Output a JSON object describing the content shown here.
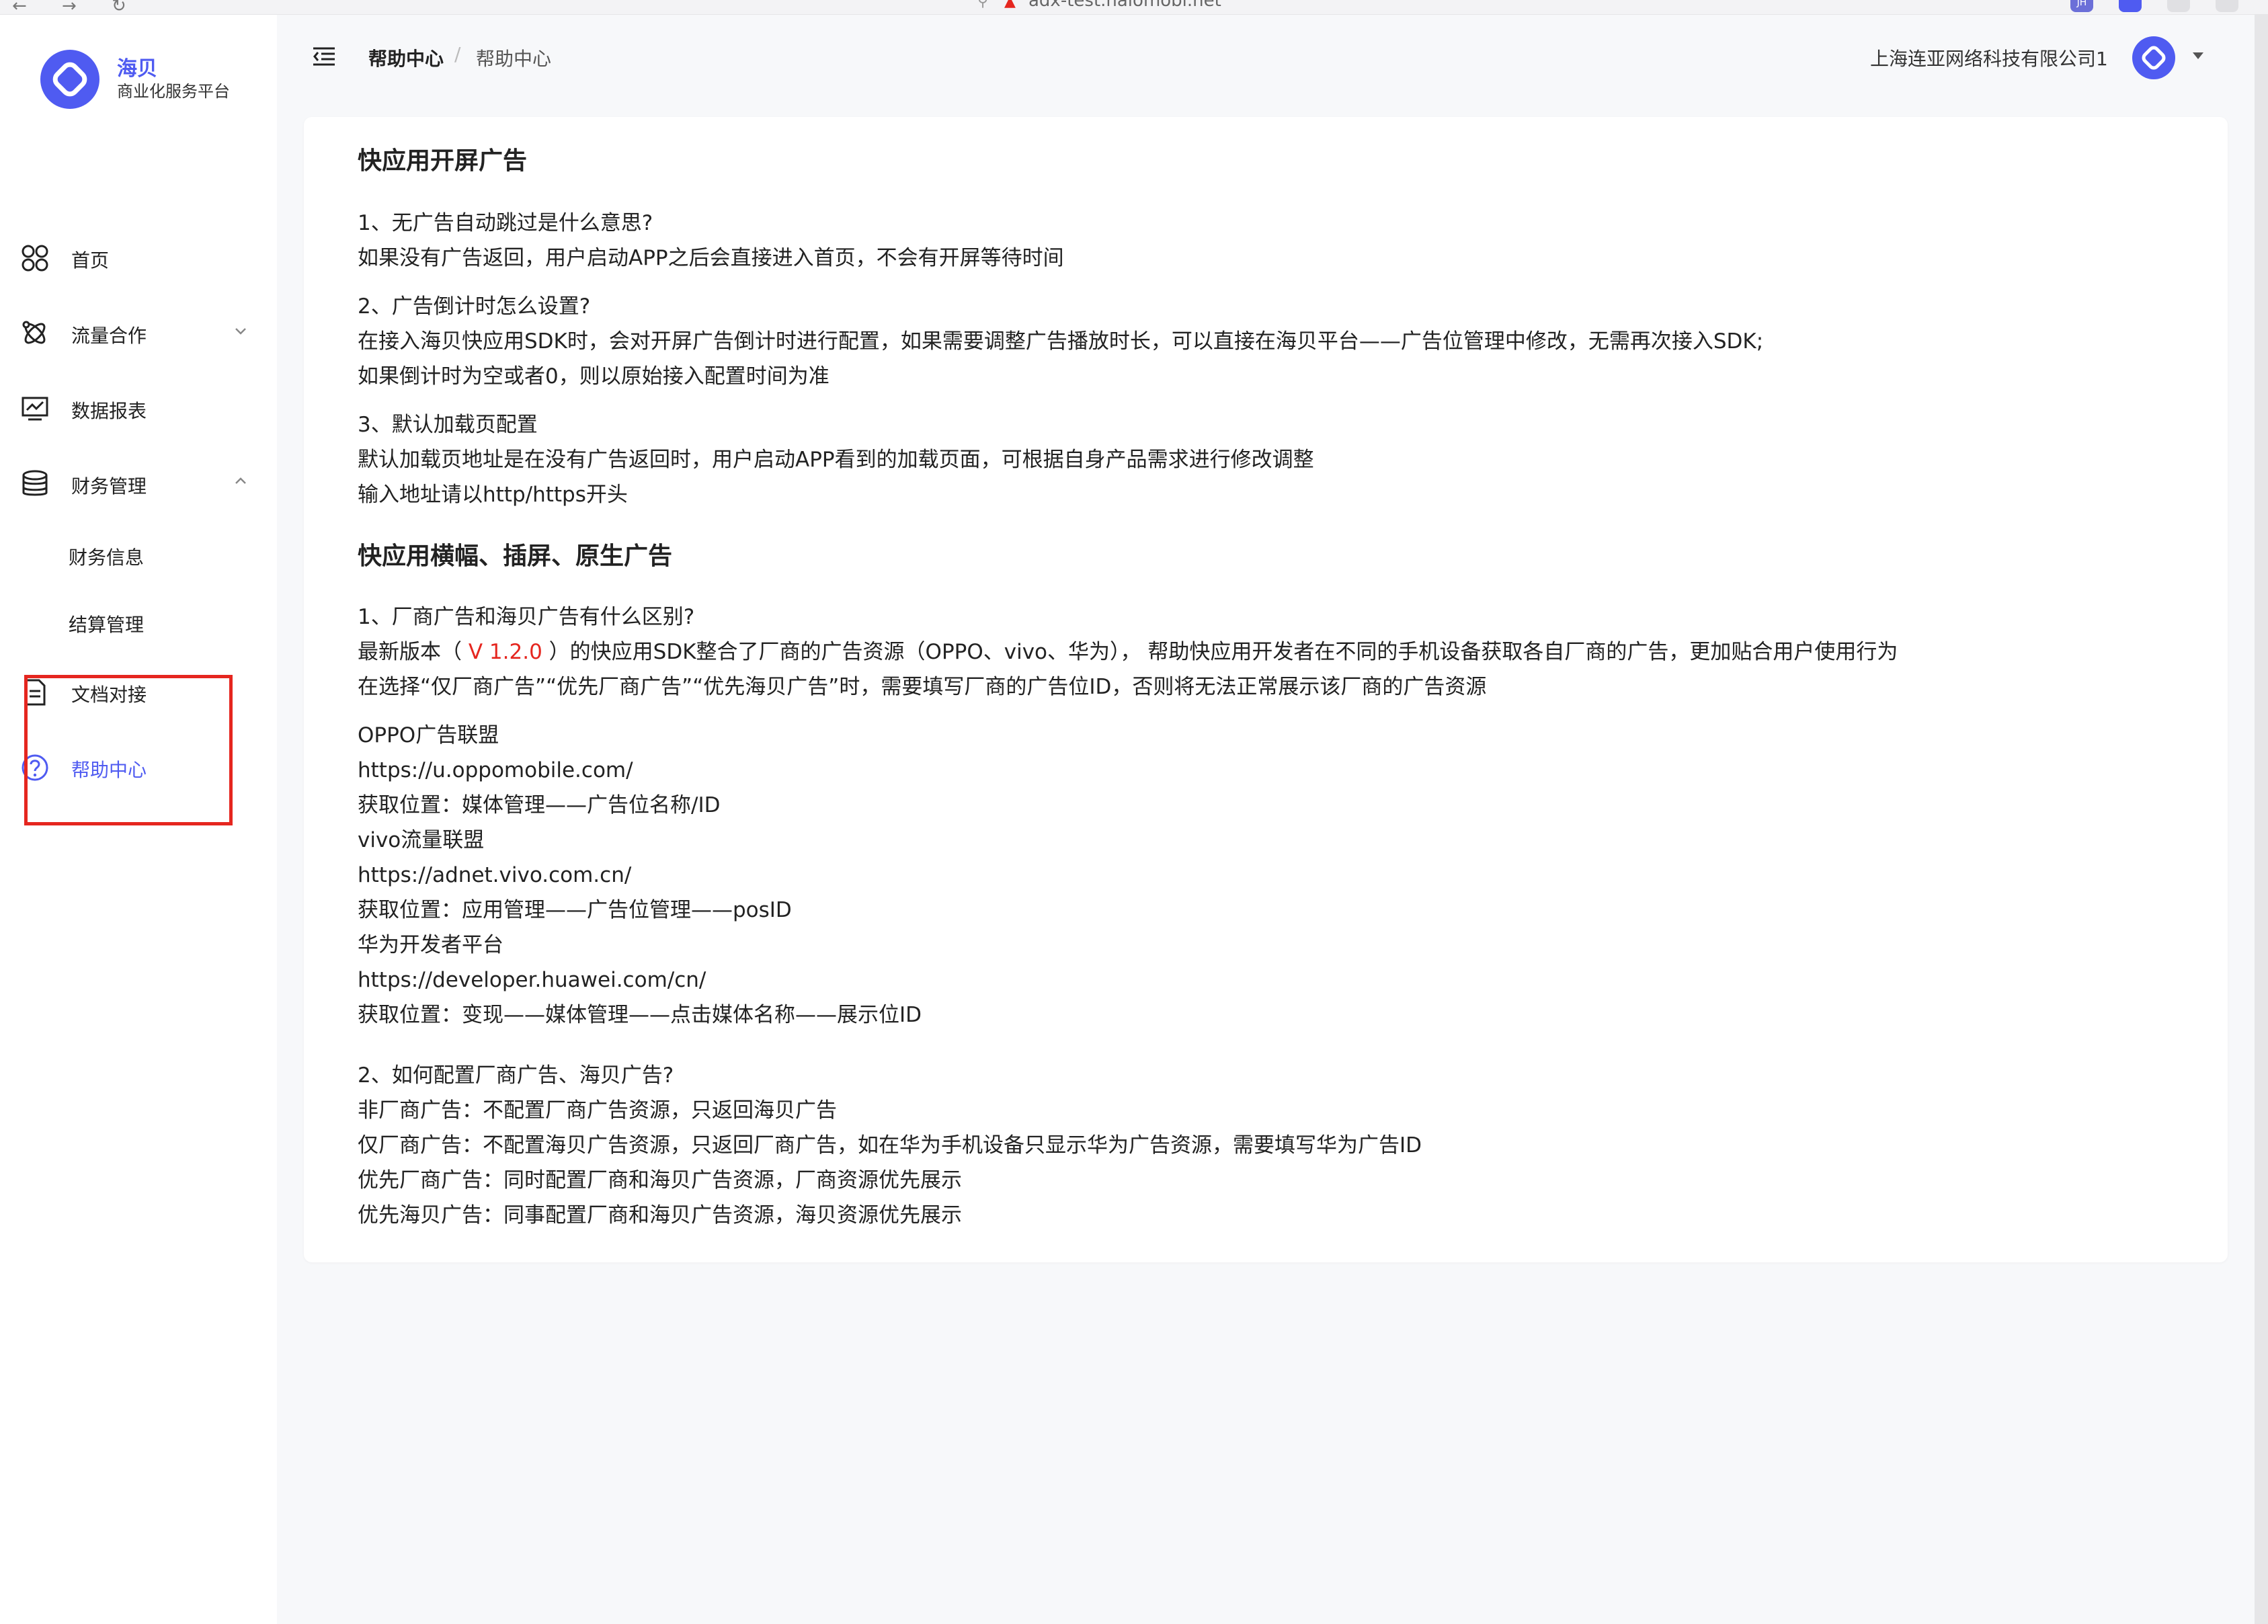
{
  "browser": {
    "url": "adx-test.haiomobi.net",
    "extension_badge": "JH"
  },
  "sidebar": {
    "brand_name": "海贝",
    "brand_subtitle": "商业化服务平台",
    "items": [
      {
        "label": "首页",
        "icon": "home-grid-icon"
      },
      {
        "label": "流量合作",
        "icon": "traffic-icon",
        "expanded": false
      },
      {
        "label": "数据报表",
        "icon": "report-chart-icon"
      },
      {
        "label": "财务管理",
        "icon": "finance-database-icon",
        "expanded": true
      },
      {
        "label": "文档对接",
        "icon": "document-icon"
      },
      {
        "label": "帮助中心",
        "icon": "help-circle-icon",
        "active": true
      }
    ],
    "finance_children": [
      "财务信息",
      "结算管理"
    ]
  },
  "header": {
    "breadcrumb": [
      "帮助中心",
      "帮助中心"
    ],
    "company": "上海连亚网络科技有限公司1"
  },
  "content": {
    "section1_title": "快应用开屏广告",
    "q1": "1、无广告自动跳过是什么意思?",
    "a1": "如果没有广告返回，用户启动APP之后会直接进入首页，不会有开屏等待时间",
    "q2": "2、广告倒计时怎么设置?",
    "a2_1": "在接入海贝快应用SDK时，会对开屏广告倒计时进行配置，如果需要调整广告播放时长，可以直接在海贝平台——广告位管理中修改，无需再次接入SDK;",
    "a2_2": "如果倒计时为空或者0，则以原始接入配置时间为准",
    "q3": "3、默认加载页配置",
    "a3_1": "默认加载页地址是在没有广告返回时，用户启动APP看到的加载页面，可根据自身产品需求进行修改调整",
    "a3_2": "输入地址请以http/https开头",
    "section2_title": "快应用横幅、插屏、原生广告",
    "q4": "1、厂商广告和海贝广告有什么区别?",
    "a4_prefix": "最新版本（ ",
    "a4_version": "V 1.2.0",
    "a4_suffix": " ）的快应用SDK整合了厂商的广告资源（OPPO、vivo、华为）， 帮助快应用开发者在不同的手机设备获取各自厂商的广告，更加贴合用户使用行为",
    "a4_2": "在选择“仅厂商广告”“优先厂商广告”“优先海贝广告”时，需要填写厂商的广告位ID，否则将无法正常展示该厂商的广告资源",
    "vendors": [
      "OPPO广告联盟",
      "https://u.oppomobile.com/",
      "获取位置：媒体管理——广告位名称/ID",
      "vivo流量联盟",
      "https://adnet.vivo.com.cn/",
      "获取位置：应用管理——广告位管理——posID",
      "华为开发者平台",
      "https://developer.huawei.com/cn/",
      "获取位置：变现——媒体管理——点击媒体名称——展示位ID"
    ],
    "q5": "2、如何配置厂商广告、海贝广告?",
    "a5": [
      "非厂商广告：不配置厂商广告资源，只返回海贝广告",
      "仅厂商广告：不配置海贝广告资源，只返回厂商广告，如在华为手机设备只显示华为广告资源，需要填写华为广告ID",
      "优先厂商广告：同时配置厂商和海贝广告资源，厂商资源优先展示",
      "优先海贝广告：同事配置厂商和海贝广告资源，海贝资源优先展示"
    ]
  },
  "colors": {
    "accent": "#4f5bf1",
    "highlight_border": "#e5261f",
    "version_text": "#e5261f"
  }
}
